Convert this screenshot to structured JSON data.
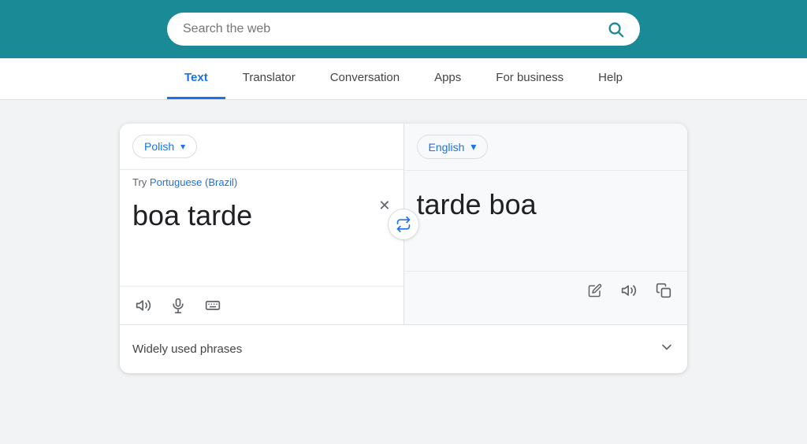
{
  "header": {
    "search_placeholder": "Search the web",
    "search_value": ""
  },
  "nav": {
    "items": [
      {
        "label": "Text",
        "active": true
      },
      {
        "label": "Translator",
        "active": false
      },
      {
        "label": "Conversation",
        "active": false
      },
      {
        "label": "Apps",
        "active": false
      },
      {
        "label": "For business",
        "active": false
      },
      {
        "label": "Help",
        "active": false
      }
    ]
  },
  "translator": {
    "source_lang": "Polish",
    "target_lang": "English",
    "suggest_prefix": "Try",
    "suggest_lang": "Portuguese (Brazil)",
    "source_text": "boa tarde",
    "target_text": "tarde boa",
    "phrases_label": "Widely used phrases",
    "icons": {
      "search": "🔍",
      "speaker_source": "🔊",
      "mic": "🎤",
      "keyboard": "⌨",
      "edit": "✏",
      "speaker_target": "🔊",
      "copy": "⧉",
      "swap": "⇄",
      "clear": "✕",
      "chevron_down": "▾",
      "chevron_down_phrases": "∨"
    }
  }
}
